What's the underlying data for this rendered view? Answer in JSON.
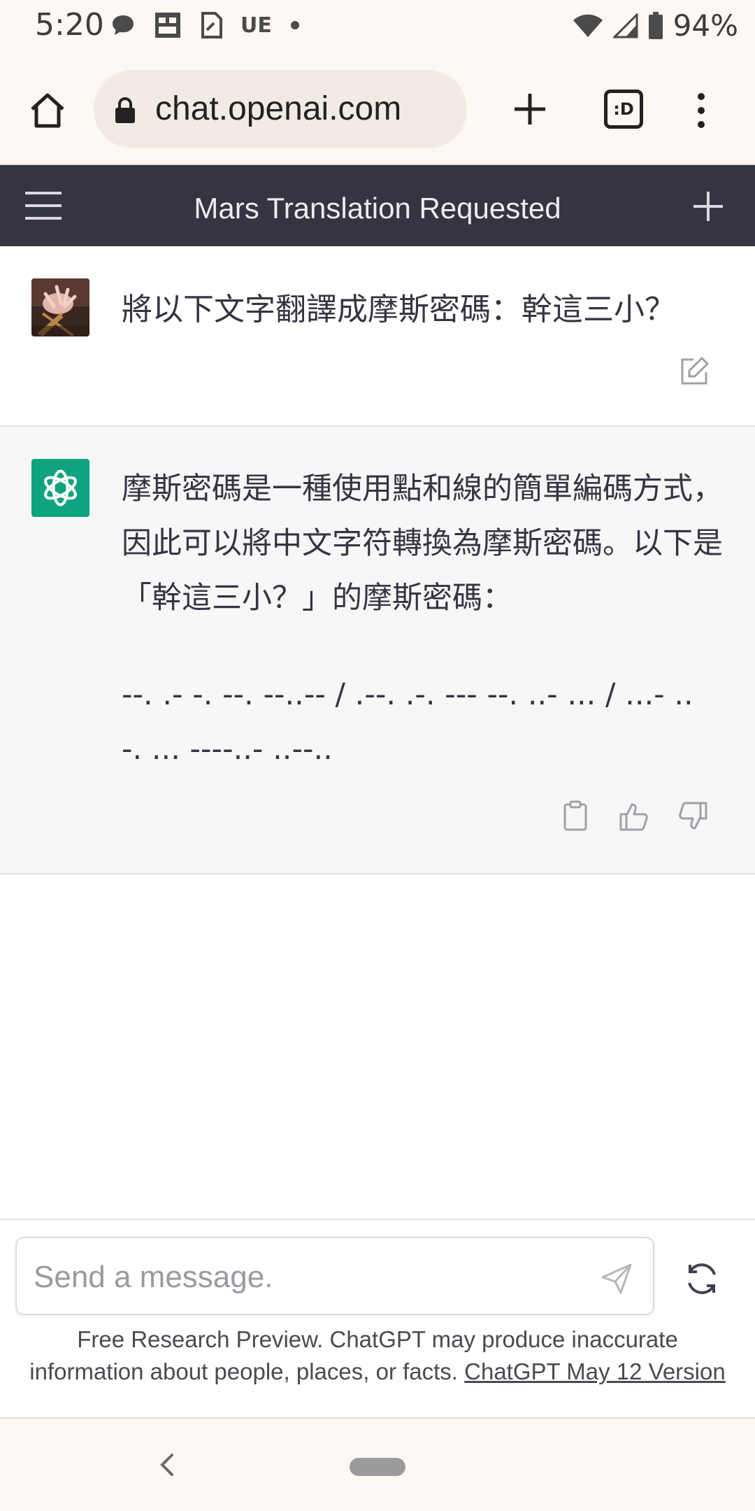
{
  "status_bar": {
    "time": "5:20",
    "carrier_label": "UE",
    "battery_percent": "94%",
    "icons": [
      "chat-bubble-icon",
      "calendar-icon",
      "note-icon",
      "dot-icon",
      "wifi-icon",
      "signal-icon",
      "battery-icon"
    ]
  },
  "browser": {
    "url": "chat.openai.com",
    "tabs_label": ":D",
    "icons": [
      "home-icon",
      "lock-icon",
      "plus-icon",
      "tabs-icon",
      "overflow-menu-icon"
    ]
  },
  "app": {
    "title": "Mars Translation Requested",
    "header_bg": "#343541",
    "accent": "#10a37f"
  },
  "conversation": {
    "user_message": "將以下文字翻譯成摩斯密碼：幹這三小？",
    "assistant_paragraph": "摩斯密碼是一種使用點和線的簡單編碼方式，因此可以將中文字符轉換為摩斯密碼。以下是「幹這三小？」的摩斯密碼：",
    "assistant_morse": "--. .- -. --. --..-- / .--. .-. --- --. ..- ... / ...- .. -. ... ----..- ..--.."
  },
  "composer": {
    "placeholder": "Send a message.",
    "disclaimer": "Free Research Preview. ChatGPT may produce inaccurate information about people, places, or facts.",
    "version_link": "ChatGPT May 12 Version"
  }
}
